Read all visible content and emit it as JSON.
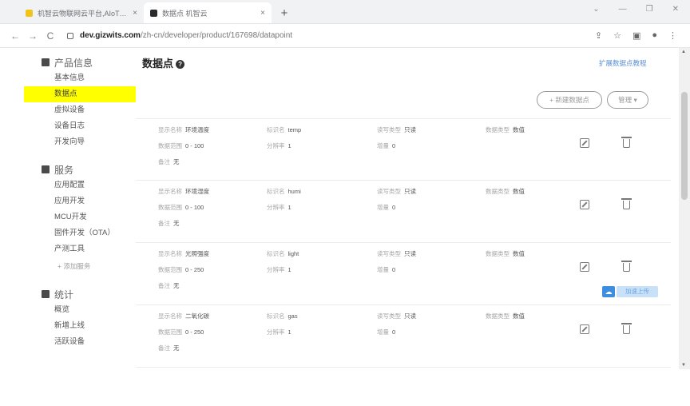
{
  "browser": {
    "tabs": [
      {
        "title": "机智云物联网云平台,AIoT开发..."
      },
      {
        "title": "数据点 机智云"
      }
    ],
    "new_tab_label": "+",
    "tab_close_label": "×",
    "window_controls": [
      "⌄",
      "—",
      "❐",
      "✕"
    ],
    "nav": {
      "back": "←",
      "forward": "→",
      "reload": "C"
    },
    "url_host": "dev.gizwits.com",
    "url_path": "/zh-cn/developer/product/167698/datapoint",
    "tool_icons": [
      "⇪",
      "☆",
      "▣",
      "●",
      "⋮"
    ]
  },
  "sidebar": {
    "sections": [
      {
        "title": "产品信息",
        "icon": "grid-icon",
        "items": [
          "基本信息",
          "数据点",
          "虚拟设备",
          "设备日志",
          "开发向导"
        ]
      },
      {
        "title": "服务",
        "icon": "book-icon",
        "items": [
          "应用配置",
          "应用开发",
          "MCU开发",
          "固件开发（OTA）",
          "产测工具"
        ]
      },
      {
        "title": "统计",
        "icon": "chart-icon",
        "items": [
          "概览",
          "新增上线",
          "活跃设备"
        ]
      }
    ],
    "active_item": "数据点",
    "add_service_label": "+ 添加服务"
  },
  "main": {
    "title": "数据点",
    "help_icon": "?",
    "top_link": "扩展数据点教程",
    "add_button": "+ 新建数据点",
    "manage_button": "管理 ▾",
    "datapoints": [
      {
        "display_label": "显示名称",
        "display": "环境温度",
        "id_label": "标识名",
        "id": "temp",
        "rw_label": "读写类型",
        "rw": "只读",
        "type_label": "数据类型",
        "type": "数值",
        "range_label": "数据范围",
        "range": "0 - 100",
        "ratio_label": "分辨率",
        "ratio": "1",
        "offset_label": "增量",
        "offset": "0",
        "note_label": "备注",
        "note": "无"
      },
      {
        "display_label": "显示名称",
        "display": "环境湿度",
        "id_label": "标识名",
        "id": "humi",
        "rw_label": "读写类型",
        "rw": "只读",
        "type_label": "数据类型",
        "type": "数值",
        "range_label": "数据范围",
        "range": "0 - 100",
        "ratio_label": "分辨率",
        "ratio": "1",
        "offset_label": "增量",
        "offset": "0",
        "note_label": "备注",
        "note": "无"
      },
      {
        "display_label": "显示名称",
        "display": "光照强度",
        "id_label": "标识名",
        "id": "light",
        "rw_label": "读写类型",
        "rw": "只读",
        "type_label": "数据类型",
        "type": "数值",
        "range_label": "数据范围",
        "range": "0 - 250",
        "ratio_label": "分辨率",
        "ratio": "1",
        "offset_label": "增量",
        "offset": "0",
        "note_label": "备注",
        "note": "无"
      },
      {
        "display_label": "显示名称",
        "display": "二氧化碳",
        "id_label": "标识名",
        "id": "gas",
        "rw_label": "读写类型",
        "rw": "只读",
        "type_label": "数据类型",
        "type": "数值",
        "range_label": "数据范围",
        "range": "0 - 250",
        "ratio_label": "分辨率",
        "ratio": "1",
        "offset_label": "增量",
        "offset": "0",
        "note_label": "备注",
        "note": "无"
      }
    ],
    "float_badge": "加速上传"
  }
}
